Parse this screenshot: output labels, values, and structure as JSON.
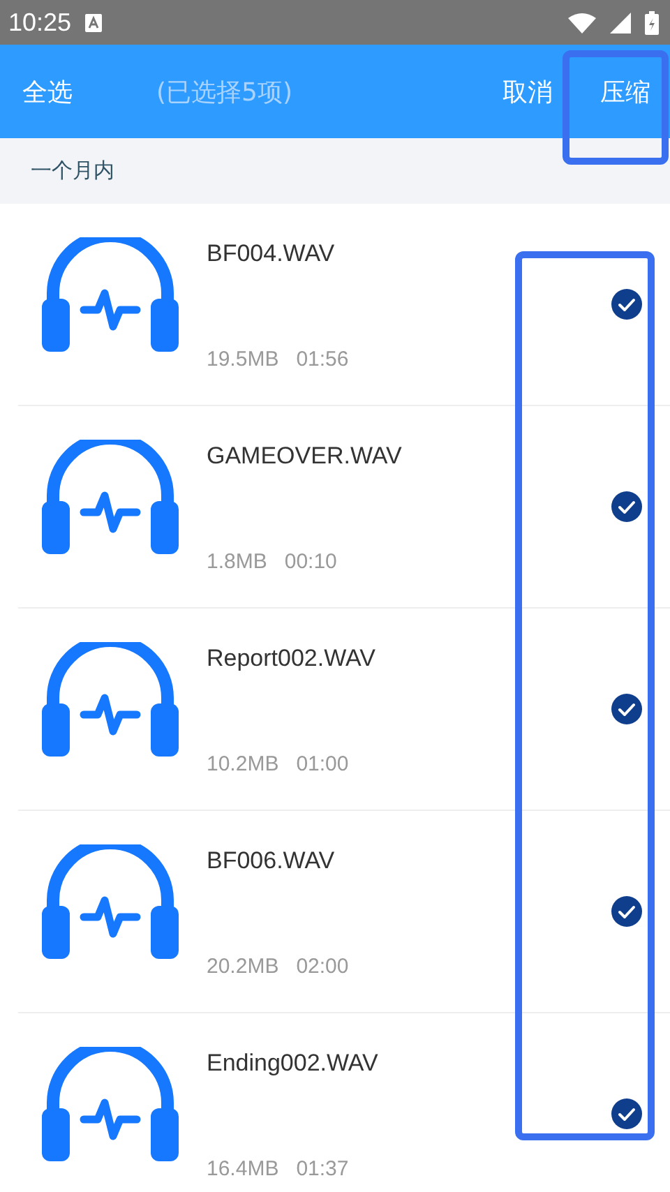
{
  "status_bar": {
    "time": "10:25"
  },
  "app_bar": {
    "select_all": "全选",
    "selection_count": "(已选择5项)",
    "cancel": "取消",
    "compress": "压缩"
  },
  "section": {
    "title": "一个月内"
  },
  "files": [
    {
      "name": "BF004.WAV",
      "size": "19.5MB",
      "duration": "01:56",
      "selected": true
    },
    {
      "name": "GAMEOVER.WAV",
      "size": "1.8MB",
      "duration": "00:10",
      "selected": true
    },
    {
      "name": "Report002.WAV",
      "size": "10.2MB",
      "duration": "01:00",
      "selected": true
    },
    {
      "name": "BF006.WAV",
      "size": "20.2MB",
      "duration": "02:00",
      "selected": true
    },
    {
      "name": "Ending002.WAV",
      "size": "16.4MB",
      "duration": "01:37",
      "selected": true
    }
  ]
}
